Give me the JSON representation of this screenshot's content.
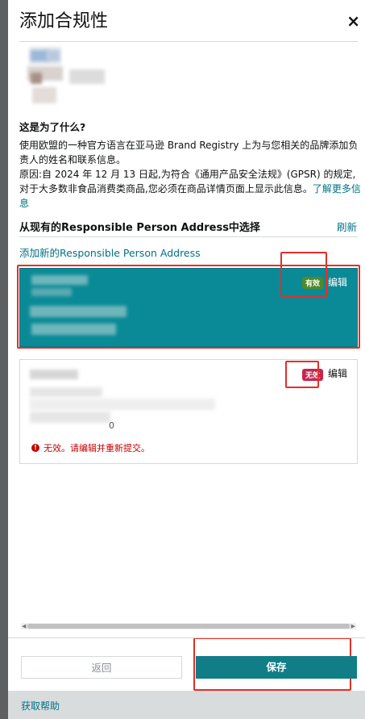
{
  "dialog": {
    "title": "添加合规性",
    "close_icon": "×"
  },
  "info": {
    "question": "这是为了什么?",
    "line1": "使用欧盟的一种官方语言在亚马逊 Brand Registry 上为与您相关的品牌添加负责人的姓名和联系信息。",
    "line2": "原因:自 2024 年 12 月 13 日起,为符合《通用产品安全法规》(GPSR) 的规定,对于大多数非食品消费类商品,您必须在商品详情页面上显示此信息。",
    "learn_more": "了解更多信息"
  },
  "section": {
    "title": "从现有的Responsible Person Address中选择",
    "refresh": "刷新",
    "add_new": "添加新的Responsible Person Address"
  },
  "addresses": [
    {
      "status": "有效",
      "edit": "编辑",
      "selected": true
    },
    {
      "status": "无效",
      "edit": "编辑",
      "selected": false,
      "partial_text": "0",
      "error": "无效。请编辑并重新提交。"
    }
  ],
  "buttons": {
    "back": "返回",
    "save": "保存"
  },
  "footer": {
    "help": "获取帮助"
  },
  "colors": {
    "selected_card": "#0a8a96",
    "valid_badge": "#4e8a2a",
    "invalid_badge": "#c7254e",
    "primary_button": "#107d87",
    "link": "#007185",
    "annotation": "#e0302a"
  }
}
